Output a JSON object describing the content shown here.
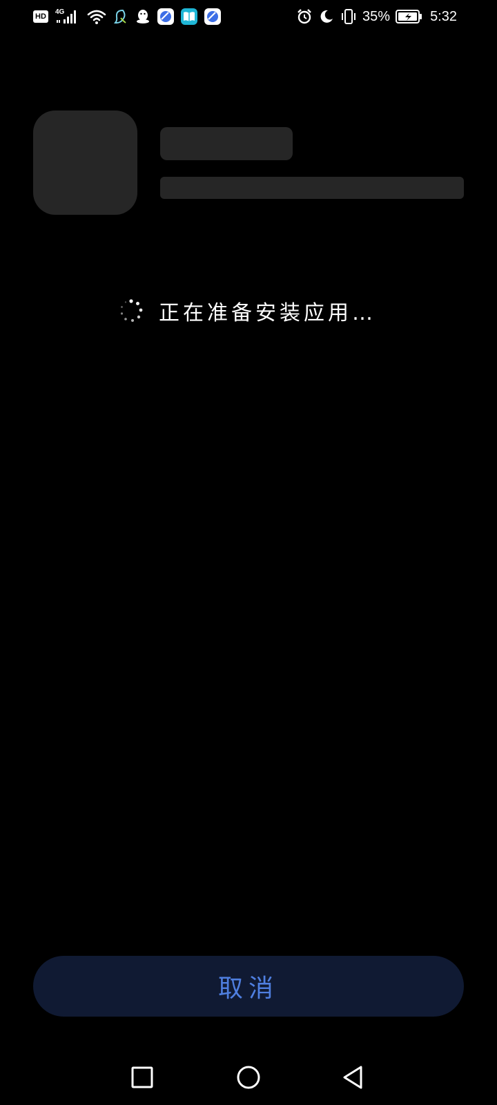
{
  "status_bar": {
    "hd_label": "HD",
    "network_label": "4G",
    "battery_percent": "35%",
    "time": "5:32",
    "icons": [
      "hd-icon",
      "signal-icon",
      "wifi-icon",
      "app-notification-icon",
      "qq-icon",
      "browser-icon",
      "reader-icon",
      "browser-icon",
      "alarm-icon",
      "do-not-disturb-icon",
      "vibrate-icon",
      "battery-charging-icon"
    ]
  },
  "main": {
    "status_text": "正在准备安装应用…"
  },
  "actions": {
    "cancel_label": "取消"
  },
  "navigation": {
    "icons": [
      "recent-apps-icon",
      "home-icon",
      "back-icon"
    ]
  },
  "colors": {
    "background": "#000000",
    "placeholder": "#262626",
    "button_bg": "#101a33",
    "accent": "#4f7fe0"
  }
}
